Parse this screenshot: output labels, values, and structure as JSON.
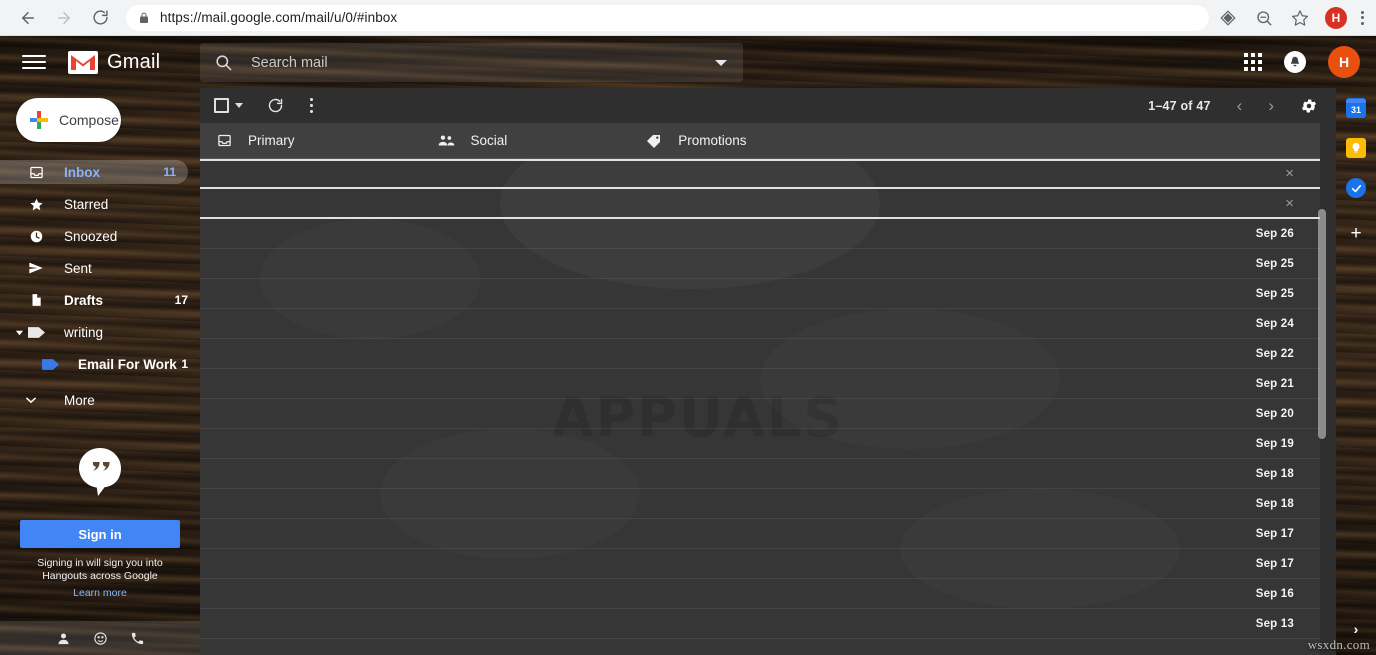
{
  "browser": {
    "back_label": "back-arrow",
    "forward_label": "forward-arrow",
    "reload_label": "reload",
    "url_scheme": "https://",
    "url_main": "mail.google.com",
    "url_path": "/mail/u/0/#inbox",
    "url_full": "https://mail.google.com/mail/u/0/#inbox",
    "profile_initial": "H",
    "icons": [
      "cast-icon",
      "zoom-icon",
      "bookmark-star-icon",
      "profile-avatar",
      "chrome-menu-icon"
    ]
  },
  "header": {
    "menu_icon": "hamburger-icon",
    "brand": "Gmail",
    "search_placeholder": "Search mail",
    "search_value": "",
    "search_options_icon": "caret-down-icon",
    "apps_icon": "apps-grid-icon",
    "notifications_icon": "bell-icon",
    "account_initial": "H"
  },
  "sidebar": {
    "compose_label": "Compose",
    "items": [
      {
        "label": "Inbox",
        "count": "11",
        "icon": "inbox-icon",
        "active": true,
        "bold": true
      },
      {
        "label": "Starred",
        "count": "",
        "icon": "star-icon",
        "active": false,
        "bold": false
      },
      {
        "label": "Snoozed",
        "count": "",
        "icon": "clock-icon",
        "active": false,
        "bold": false
      },
      {
        "label": "Sent",
        "count": "",
        "icon": "send-icon",
        "active": false,
        "bold": false
      },
      {
        "label": "Drafts",
        "count": "17",
        "icon": "draft-icon",
        "active": false,
        "bold": true
      },
      {
        "label": "writing",
        "count": "",
        "icon": "label-icon",
        "active": false,
        "bold": false
      },
      {
        "label": "Email For Work",
        "count": "1",
        "icon": "label-blue-icon",
        "active": false,
        "bold": true
      },
      {
        "label": "More",
        "count": "",
        "icon": "chevron-down-icon",
        "active": false,
        "bold": false
      }
    ],
    "hangouts": {
      "icon": "hangouts-icon",
      "signin_label": "Sign in",
      "note": "Signing in will sign you into Hangouts across Google",
      "link_label": "Learn more"
    },
    "footer_icons": [
      "contact-person-icon",
      "emoji-smiley-icon",
      "phone-call-icon"
    ]
  },
  "toolbar": {
    "select_all_icon": "checkbox-icon",
    "select_caret_icon": "caret-down-icon",
    "refresh_icon": "refresh-icon",
    "more_icon": "kebab-menu-icon",
    "pagination": "1–47 of 47",
    "prev_icon": "chevron-left-icon",
    "next_icon": "chevron-right-icon",
    "settings_icon": "gear-icon"
  },
  "tabs": [
    {
      "label": "Primary",
      "icon": "inbox-tab-icon"
    },
    {
      "label": "Social",
      "icon": "people-icon"
    },
    {
      "label": "Promotions",
      "icon": "tag-icon"
    }
  ],
  "mail_rows": [
    {
      "date": "",
      "dismiss": "×",
      "ad": true
    },
    {
      "date": "",
      "dismiss": "×",
      "ad": true
    },
    {
      "date": "Sep 26",
      "dismiss": "",
      "ad": false
    },
    {
      "date": "Sep 25",
      "dismiss": "",
      "ad": false
    },
    {
      "date": "Sep 25",
      "dismiss": "",
      "ad": false
    },
    {
      "date": "Sep 24",
      "dismiss": "",
      "ad": false
    },
    {
      "date": "Sep 22",
      "dismiss": "",
      "ad": false
    },
    {
      "date": "Sep 21",
      "dismiss": "",
      "ad": false
    },
    {
      "date": "Sep 20",
      "dismiss": "",
      "ad": false
    },
    {
      "date": "Sep 19",
      "dismiss": "",
      "ad": false
    },
    {
      "date": "Sep 18",
      "dismiss": "",
      "ad": false
    },
    {
      "date": "Sep 18",
      "dismiss": "",
      "ad": false
    },
    {
      "date": "Sep 17",
      "dismiss": "",
      "ad": false
    },
    {
      "date": "Sep 17",
      "dismiss": "",
      "ad": false
    },
    {
      "date": "Sep 16",
      "dismiss": "",
      "ad": false
    },
    {
      "date": "Sep 13",
      "dismiss": "",
      "ad": false
    }
  ],
  "right_rail": {
    "calendar_day": "31",
    "icons": [
      "calendar-icon",
      "keep-icon",
      "tasks-icon",
      "add-addon-icon"
    ],
    "plus_label": "+",
    "expand_label": "›"
  },
  "watermarks": {
    "center": "APPUALS",
    "corner": "wsxdn.com"
  },
  "colors": {
    "accent_blue": "#4285f4",
    "active_blue": "#8ab4f8",
    "avatar_orange": "#e8500f",
    "gmail_red": "#d93025",
    "keep_yellow": "#fbbc04"
  }
}
